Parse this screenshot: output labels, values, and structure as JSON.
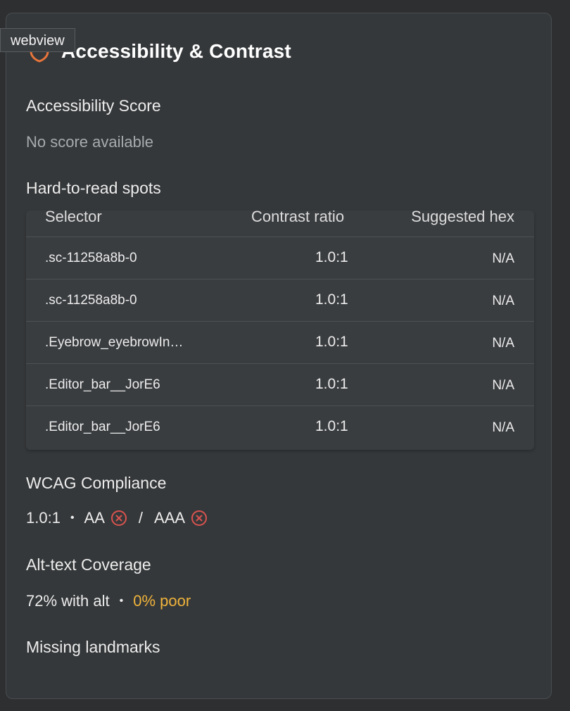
{
  "tooltip": "webview",
  "panel": {
    "title": "Accessibility & Contrast"
  },
  "score": {
    "label": "Accessibility Score",
    "value": "No score available"
  },
  "spots": {
    "label": "Hard-to-read spots",
    "columns": [
      "Selector",
      "Contrast ratio",
      "Suggested hex"
    ],
    "rows": [
      {
        "selector": ".sc-11258a8b-0",
        "ratio": "1.0:1",
        "hex": "N/A"
      },
      {
        "selector": ".sc-11258a8b-0",
        "ratio": "1.0:1",
        "hex": "N/A"
      },
      {
        "selector": ".Eyebrow_eyebrowIn…",
        "ratio": "1.0:1",
        "hex": "N/A"
      },
      {
        "selector": ".Editor_bar__JorE6",
        "ratio": "1.0:1",
        "hex": "N/A"
      },
      {
        "selector": ".Editor_bar__JorE6",
        "ratio": "1.0:1",
        "hex": "N/A"
      }
    ]
  },
  "wcag": {
    "label": "WCAG Compliance",
    "ratio": "1.0:1",
    "separator": "•",
    "aa": "AA",
    "slash": "/",
    "aaa": "AAA"
  },
  "alt": {
    "label": "Alt-text Coverage",
    "with_alt": "72% with alt",
    "separator": "•",
    "poor": "0% poor"
  },
  "landmarks": {
    "label": "Missing landmarks"
  },
  "icons": {
    "header": "shield-icon",
    "fail": "x-circle-icon"
  },
  "colors": {
    "accent": "#e8753a",
    "fail": "#d9534f",
    "warn": "#f0b43c"
  }
}
